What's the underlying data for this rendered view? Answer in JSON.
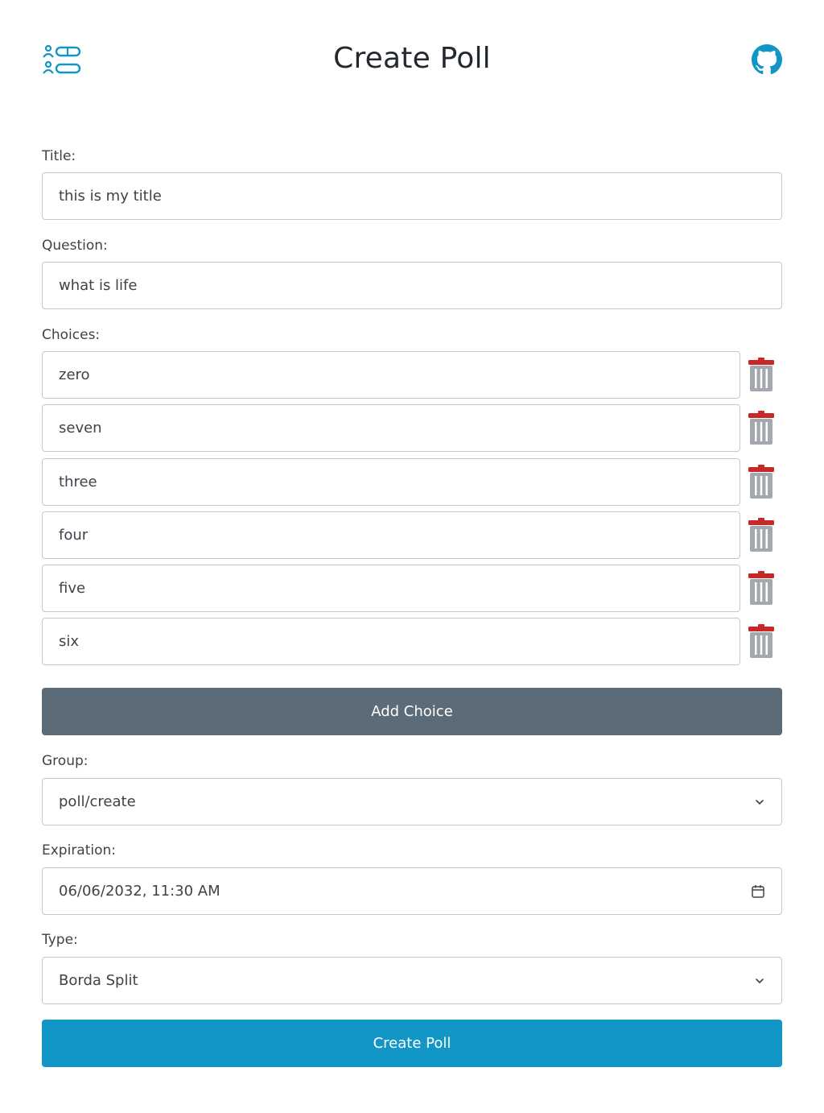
{
  "header": {
    "title": "Create Poll",
    "logo_icon": "poll-list-icon",
    "github_icon": "github-icon",
    "accent_color": "#1196c6"
  },
  "form": {
    "title": {
      "label": "Title:",
      "value": "this is my title"
    },
    "question": {
      "label": "Question:",
      "value": "what is life"
    },
    "choices": {
      "label": "Choices:",
      "items": [
        "zero",
        "seven",
        "three",
        "four",
        "five",
        "six"
      ],
      "delete_icon": "trash-icon"
    },
    "add_choice_label": "Add Choice",
    "group": {
      "label": "Group:",
      "value": "poll/create"
    },
    "expiration": {
      "label": "Expiration:",
      "value": "06/06/2032, 11:30 AM"
    },
    "type": {
      "label": "Type:",
      "value": "Borda Split"
    },
    "create_label": "Create Poll"
  },
  "colors": {
    "add_button": "#5c6b78",
    "create_button": "#1196c6",
    "trash_lid": "#c62828",
    "trash_body": "#a3a8ae"
  }
}
